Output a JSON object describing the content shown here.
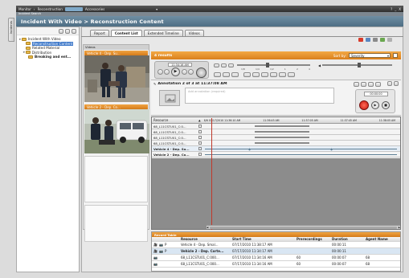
{
  "titlebar": {
    "menu_monitor": "Monitor",
    "menu_reconstruction": "Reconstruction",
    "menu_accessories": "Accessories",
    "window_controls": [
      "?",
      "_",
      "X"
    ]
  },
  "header": {
    "strip_label": "Incident Search",
    "title": "Incident With Video > Reconstruction Content"
  },
  "side_tab": {
    "label": "Incidents"
  },
  "tree": {
    "items": [
      {
        "label": "Incident With Video",
        "indent": 0
      },
      {
        "label": "Reconstruction Content",
        "indent": 1,
        "selected": true
      },
      {
        "label": "Related Material",
        "indent": 1
      },
      {
        "label": "Distribution",
        "indent": 1
      },
      {
        "label": "Breaking and ent...",
        "indent": 2
      }
    ]
  },
  "tabs": [
    {
      "label": "Report",
      "active": false
    },
    {
      "label": "Content List",
      "active": true
    },
    {
      "label": "Extended Timeline",
      "active": false
    },
    {
      "label": "Videos",
      "active": false
    }
  ],
  "thumbs": {
    "panel_label": "Videos",
    "items": [
      {
        "label": "Vehicle 4 - Dep. Su..."
      },
      {
        "label": "Vehicle 2 - Dep. Co..."
      }
    ]
  },
  "results": {
    "count_label": "4 results",
    "sort_label": "Sort by:",
    "sort_value": "Severity"
  },
  "player": {
    "time_display": "11:34:16 AM",
    "speed_markers": [
      "1/8",
      "1/4",
      "1/2",
      "1",
      "2",
      "4"
    ]
  },
  "annotation": {
    "header": "Annotation 2 of 3 at 11:37:08 AM",
    "placeholder": "Add annotation (required)",
    "time_field": "00:00:00"
  },
  "timeline": {
    "resource_header": "Resource",
    "ticks": [
      "6/6 07/17/2010 11:36:10 AM",
      "11:36:45 AM",
      "11:37:05 AM",
      "11:37:45 AM",
      "11:38:05 AM"
    ],
    "rows": [
      {
        "label": "68_L11CSTU01_C:0..."
      },
      {
        "label": "68_L11CSTU01_C:0..."
      },
      {
        "label": "68_L11CSTU01_C:0..."
      },
      {
        "label": "68_L11CSTU01_C:0..."
      },
      {
        "label": "Vehicle 4 - Dep. Su..."
      },
      {
        "label": "Vehicle 2 - Dep. Co..."
      }
    ]
  },
  "record_table": {
    "title": "Record Table",
    "columns": [
      "Resource",
      "Start Time",
      "Prerecordings",
      "Duration",
      "Agent Name"
    ],
    "rows": [
      {
        "flag": "P",
        "resource": "Vehicle 4 - Dep. Smal...",
        "start": "07/17/2010 11:38:17 AM",
        "pre": "",
        "duration": "00:00:11",
        "agent": ""
      },
      {
        "flag": "P",
        "resource": "Vehicle 2 - Dep. Corte...",
        "start": "07/17/2010 11:34:17 AM",
        "pre": "",
        "duration": "00:00:11",
        "agent": ""
      },
      {
        "flag": "",
        "resource": "68_L11CSTU01_C:000...",
        "start": "07/17/2010 11:34:16 AM",
        "pre": "60",
        "duration": "00:00:07",
        "agent": "68"
      },
      {
        "flag": "",
        "resource": "68_L11CSTU01_C:000...",
        "start": "07/17/2010 11:34:16 AM",
        "pre": "60",
        "duration": "00:00:07",
        "agent": "68"
      }
    ]
  },
  "colors": {
    "accent_orange": "#e08a22",
    "header_blue": "#5b7d94",
    "title_dark": "#3a3f45",
    "timeline_dark": "#8a8a8a"
  }
}
